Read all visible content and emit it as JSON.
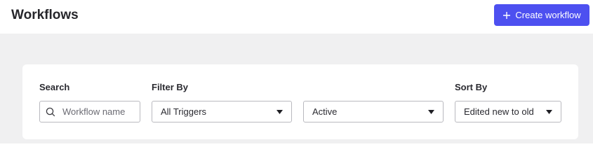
{
  "header": {
    "title": "Workflows",
    "create_button_label": "Create workflow",
    "create_button_icon": "plus-icon",
    "accent_color": "#4d50f0"
  },
  "filters": {
    "search": {
      "label": "Search",
      "placeholder": "Workflow name",
      "value": "",
      "icon": "search-icon"
    },
    "filter_by": {
      "label": "Filter By",
      "trigger_value": "All Triggers",
      "status_value": "Active",
      "icon": "caret-down-icon"
    },
    "sort_by": {
      "label": "Sort By",
      "value": "Edited new to old",
      "icon": "caret-down-icon"
    }
  }
}
